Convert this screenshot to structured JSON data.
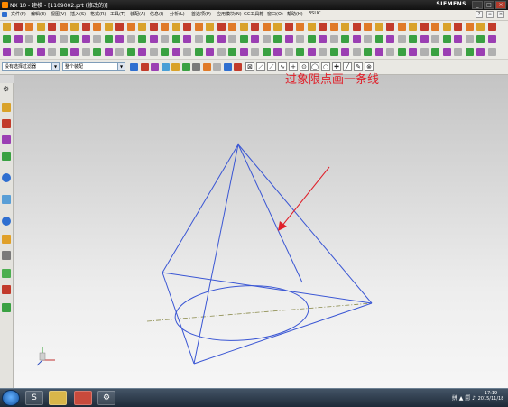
{
  "window": {
    "title": "NX 10 - 建模 - [1109002.prt (修改的)]",
    "brand": "SIEMENS",
    "buttons": [
      "_",
      "□",
      "×"
    ]
  },
  "menu": {
    "items": [
      "文件(F)",
      "编辑(E)",
      "视图(V)",
      "插入(S)",
      "格式(R)",
      "工具(T)",
      "装配(A)",
      "信息(I)",
      "分析(L)",
      "首选项(P)",
      "应用模块(N)",
      "GC工具箱",
      "窗口(O)",
      "帮助(H)",
      "3SUC"
    ]
  },
  "selection_bar": {
    "filter_value": "没有选择过滤器",
    "scope_value": "整个装配"
  },
  "canvas": {
    "annotation": "过象限点画一条线",
    "annotation_color": "#e0202a",
    "geometry_color": "#3a56d4"
  },
  "taskbar": {
    "tray_text": "拼 ▲ 🗐 ♪",
    "time": "17:19",
    "date": "2015/11/18"
  }
}
